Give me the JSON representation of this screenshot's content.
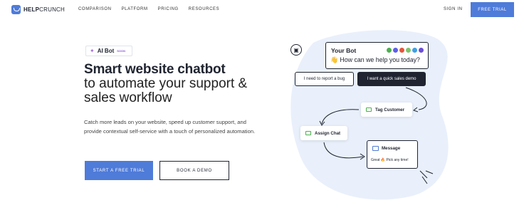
{
  "nav": {
    "brand_bold": "HELP",
    "brand_light": "CRUNCH",
    "items": [
      "COMPARISON",
      "PLATFORM",
      "PRICING",
      "RESOURCES"
    ],
    "signin": "SIGN IN",
    "cta": "FREE TRIAL"
  },
  "hero": {
    "badge_label": "AI Bot",
    "badge_soon": "SOON",
    "title": "Smart website chatbot",
    "subtitle": "to automate your support & sales workflow",
    "description": "Catch more leads on your website, speed up customer support, and provide contextual self-service with a touch of personalized automation.",
    "primary_cta": "START A FREE TRIAL",
    "secondary_cta": "BOOK A DEMO"
  },
  "illustration": {
    "bot_name": "Your Bot",
    "bot_question": "👋 How can we help you today?",
    "option_1": "I need to report a bug",
    "option_2": "I want a quick sales demo",
    "step_tag": "Tag Customer",
    "step_assign": "Assign Chat",
    "step_message": "Message",
    "message_body": "Great 🔥 Pick any time!"
  },
  "colors": {
    "accent": "#4f7bd9",
    "blob": "#e9f0fb",
    "dark": "#1f2430"
  }
}
